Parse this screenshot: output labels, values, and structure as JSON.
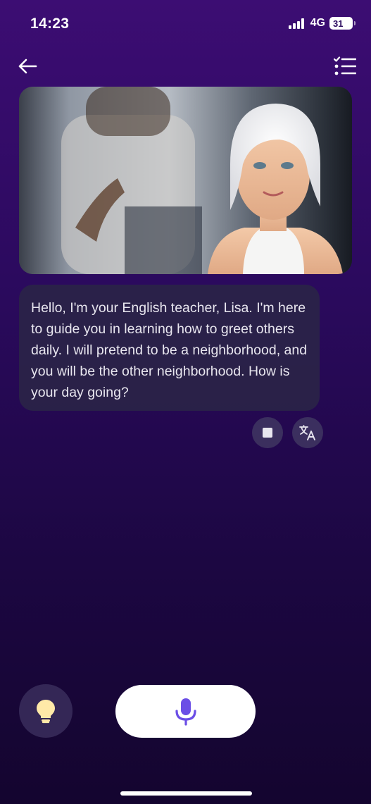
{
  "status_bar": {
    "time": "14:23",
    "network": "4G",
    "battery": "31"
  },
  "header": {
    "back_icon": "arrow-left-icon",
    "menu_icon": "checklist-icon"
  },
  "hero": {
    "image": "teacher-avatar-illustration"
  },
  "message": {
    "text": "Hello, I'm your English teacher, Lisa. I'm here to guide you in learning how to greet others daily. I will pretend to be a neighborhood, and you will be the other neighborhood. How is your day going?"
  },
  "message_actions": {
    "stop_icon": "stop-icon",
    "translate_icon": "translate-icon"
  },
  "bottom_bar": {
    "hint_icon": "lightbulb-icon",
    "mic_icon": "microphone-icon",
    "mic_color": "#6b4ee6",
    "bulb_color": "#ffe9a8"
  }
}
